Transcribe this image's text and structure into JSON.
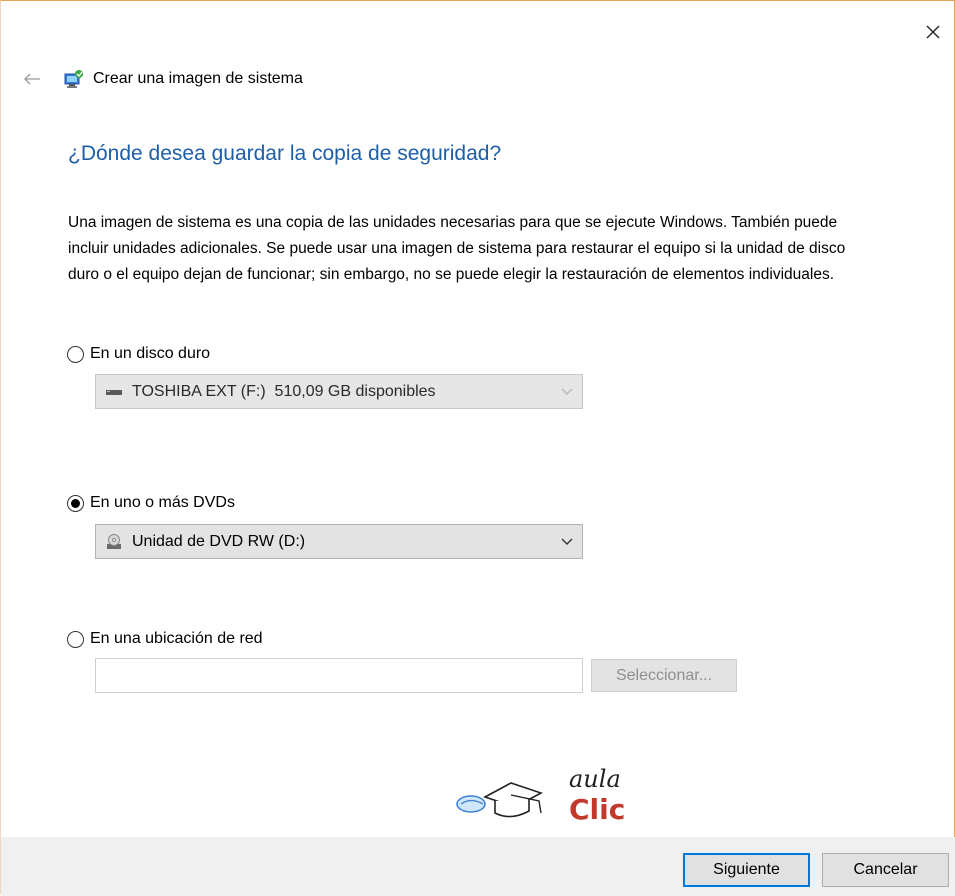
{
  "window": {
    "title": "Crear una imagen de sistema"
  },
  "heading": "¿Dónde desea guardar la copia de seguridad?",
  "description": "Una imagen de sistema es una copia de las unidades necesarias para que se ejecute Windows. También puede incluir unidades adicionales. Se puede usar una imagen de sistema para restaurar el equipo si la unidad de disco duro o el equipo dejan de funcionar; sin embargo, no se puede elegir la restauración de elementos individuales.",
  "options": {
    "hard_disk": {
      "label": "En un disco duro",
      "selected": false,
      "dropdown_value": "TOSHIBA EXT (F:)  510,09 GB disponibles",
      "dropdown_enabled": false
    },
    "dvd": {
      "label": "En uno o más DVDs",
      "selected": true,
      "dropdown_value": "Unidad de DVD RW (D:)",
      "dropdown_enabled": true
    },
    "network": {
      "label": "En una ubicación de red",
      "selected": false,
      "input_value": "",
      "select_button_label": "Seleccionar..."
    }
  },
  "logo": {
    "text_top": "aula",
    "text_bottom": "Clic",
    "color_bottom": "#c0392b"
  },
  "footer": {
    "next_label": "Siguiente",
    "cancel_label": "Cancelar"
  },
  "colors": {
    "heading": "#1e5ea8",
    "primary_border": "#0078d7"
  }
}
